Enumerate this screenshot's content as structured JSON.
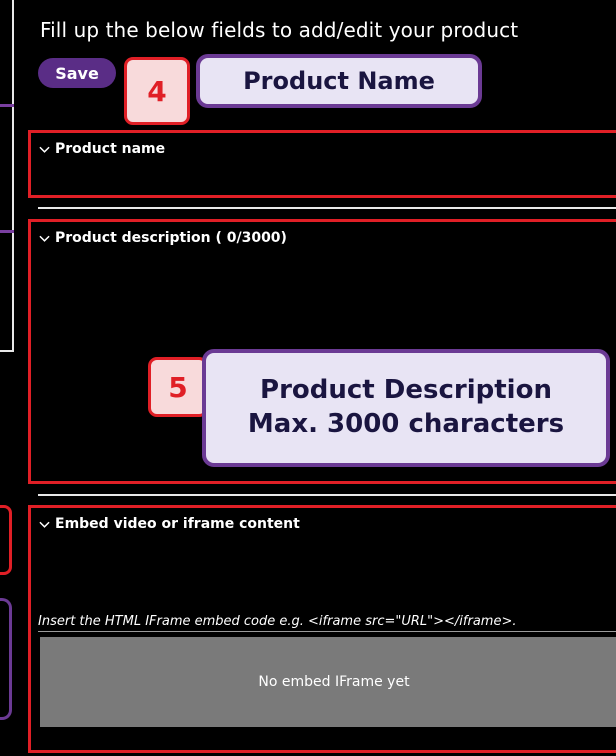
{
  "header": {
    "instruction": "Fill up the below fields to add/edit your product",
    "save_label": "Save"
  },
  "callouts": {
    "step4": {
      "number": "4",
      "label": "Product Name"
    },
    "step5": {
      "number": "5",
      "line1": "Product Description",
      "line2": "Max. 3000 characters"
    }
  },
  "sections": {
    "product_name": {
      "label": "Product name"
    },
    "product_description": {
      "label": "Product description ( 0/3000)"
    },
    "embed": {
      "label": "Embed video or iframe content",
      "hint": "Insert the HTML IFrame embed code e.g. <iframe src=\"URL\"></iframe>.",
      "placeholder": "No embed IFrame yet"
    }
  },
  "icons": {
    "chevron": "chevron-down-icon"
  },
  "colors": {
    "background": "#000000",
    "accent_purple": "#5a2d86",
    "highlight_red": "#e01f26",
    "callout_fill": "#e8e4f4",
    "embed_placeholder": "#7a7a7a"
  }
}
